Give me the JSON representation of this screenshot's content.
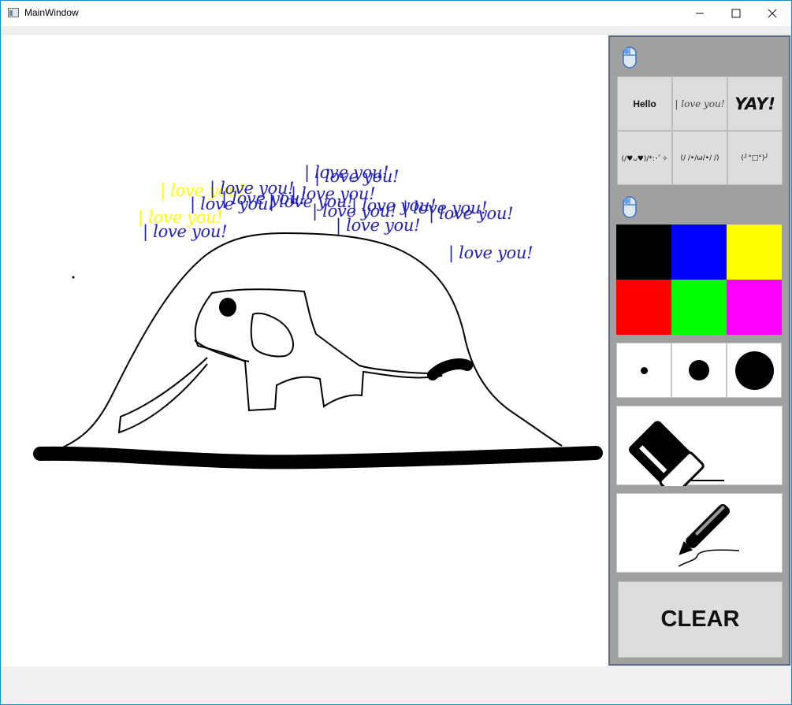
{
  "window": {
    "title": "MainWindow"
  },
  "window_controls": {
    "minimize": "—",
    "maximize": "☐",
    "close": "✕"
  },
  "canvas": {
    "love_texts": [
      {
        "text": "| love you!",
        "color": "#2222bb"
      },
      {
        "text": "| love you!",
        "color": "#2222bb"
      },
      {
        "text": "| love you!",
        "color": "#ffff00"
      },
      {
        "text": "| love you!",
        "color": "#2222bb"
      },
      {
        "text": "| love you!",
        "color": "#2222bb"
      },
      {
        "text": "| love you!",
        "color": "#2222bb"
      },
      {
        "text": "| love you!",
        "color": "#2222bb"
      },
      {
        "text": "| love you!",
        "color": "#2222bb"
      },
      {
        "text": "| love you!",
        "color": "#2222bb"
      },
      {
        "text": "| love you!",
        "color": "#2222bb"
      },
      {
        "text": "| love you!",
        "color": "#ffff00"
      },
      {
        "text": "| love you!",
        "color": "#2222bb"
      },
      {
        "text": "| love you!",
        "color": "#2222bb"
      },
      {
        "text": "| love you!",
        "color": "#2222bb"
      },
      {
        "text": "| love you!",
        "color": "#2222bb"
      },
      {
        "text": "| love you!",
        "color": "#2222bb"
      }
    ]
  },
  "panel": {
    "stamp_buttons": [
      {
        "label": "Hello"
      },
      {
        "label": "| love you!"
      },
      {
        "label": "YAY!"
      },
      {
        "label": "(/♥ᴗ♥)/*:･ﾟ✧"
      },
      {
        "label": "(/ /•/ω/•/ /)"
      },
      {
        "label": "(╯°□°)╯"
      }
    ],
    "colors": [
      {
        "name": "black",
        "hex": "#000000"
      },
      {
        "name": "blue",
        "hex": "#0000ff"
      },
      {
        "name": "yellow",
        "hex": "#ffff00"
      },
      {
        "name": "red",
        "hex": "#ff0000"
      },
      {
        "name": "green",
        "hex": "#00ff00"
      },
      {
        "name": "magenta",
        "hex": "#ff00ff"
      }
    ],
    "brush_sizes": [
      "small",
      "medium",
      "large"
    ],
    "tools": {
      "eraser": "eraser-icon",
      "pen": "pen-icon"
    },
    "clear_label": "CLEAR"
  }
}
